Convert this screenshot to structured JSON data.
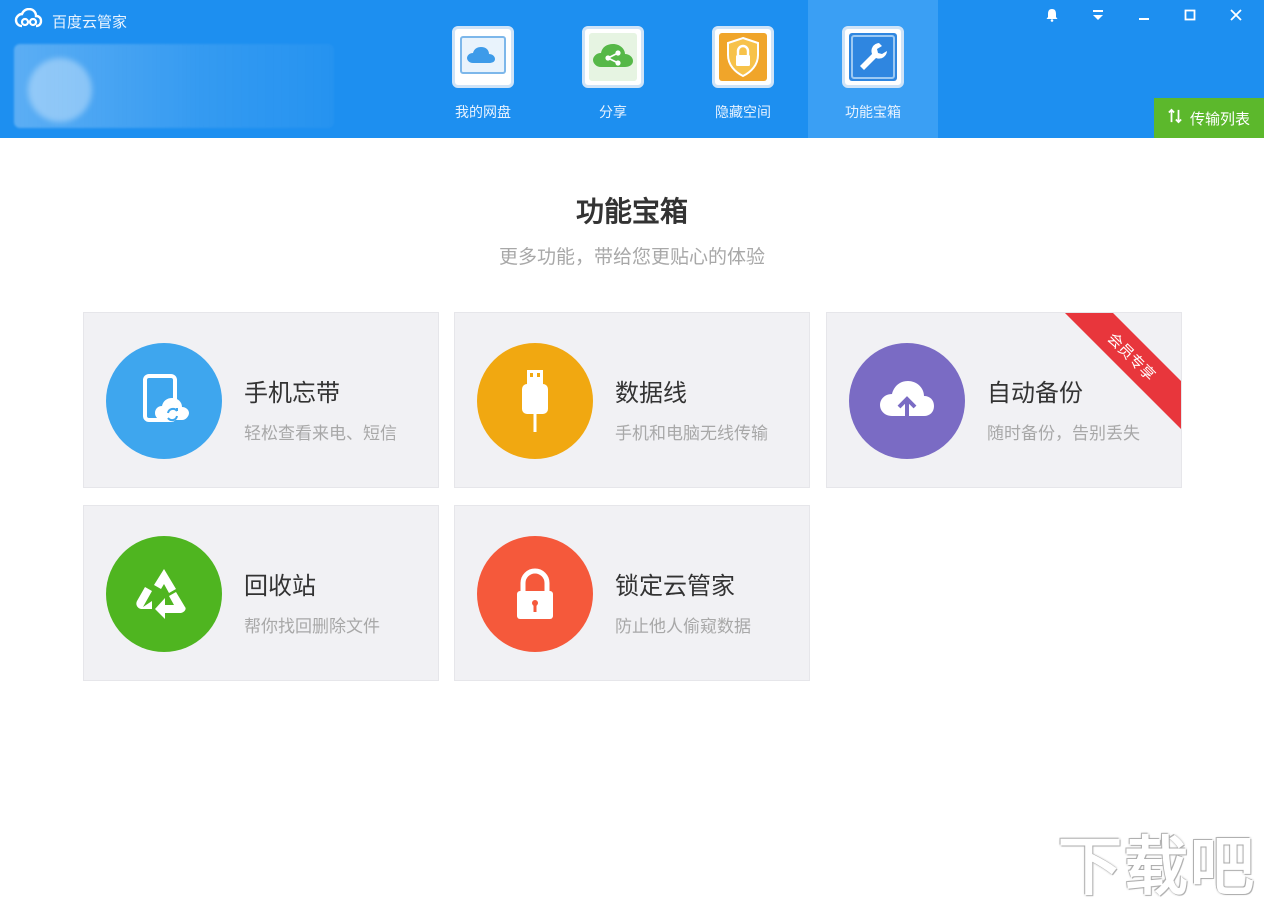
{
  "header": {
    "app_title": "百度云管家",
    "nav": [
      {
        "label": "我的网盘",
        "icon": "cloud-disk-icon",
        "color": "#ffffff",
        "active": false
      },
      {
        "label": "分享",
        "icon": "share-icon",
        "color": "#56b848",
        "active": false
      },
      {
        "label": "隐藏空间",
        "icon": "lock-shield-icon",
        "color": "#f0a52a",
        "active": false
      },
      {
        "label": "功能宝箱",
        "icon": "wrench-icon",
        "color": "#2f86e0",
        "active": true
      }
    ],
    "transfer_label": "传输列表"
  },
  "main": {
    "title": "功能宝箱",
    "subtitle": "更多功能，带给您更贴心的体验",
    "cards": [
      {
        "title": "手机忘带",
        "desc": "轻松查看来电、短信",
        "icon": "phone-sync-icon",
        "color": "#3ea6ee"
      },
      {
        "title": "数据线",
        "desc": "手机和电脑无线传输",
        "icon": "usb-cable-icon",
        "color": "#f1a811"
      },
      {
        "title": "自动备份",
        "desc": "随时备份，告别丢失",
        "icon": "cloud-upload-icon",
        "color": "#7a6bc4",
        "badge": "会员专享"
      },
      {
        "title": "回收站",
        "desc": "帮你找回删除文件",
        "icon": "recycle-icon",
        "color": "#4fb520"
      },
      {
        "title": "锁定云管家",
        "desc": "防止他人偷窥数据",
        "icon": "padlock-icon",
        "color": "#f5593b"
      }
    ]
  },
  "watermark": "下载吧",
  "colors": {
    "header": "#1d8ff0",
    "transfer": "#5cb82c",
    "ribbon": "#e8363c"
  }
}
